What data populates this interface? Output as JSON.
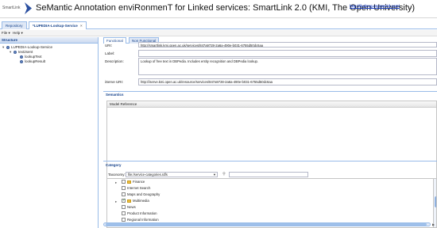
{
  "header": {
    "logo_text": "SmartLink",
    "title": "SeMantic Annotation enviRonmenT for Linked services: SmartLink 2.0 (KMI, The Open University)",
    "openid_link": "http://liudong.myopenid.com/",
    "right_text": "Lo"
  },
  "tabs": [
    {
      "label": "Repository"
    },
    {
      "label": "*LUPEDIA-Lookup-Service",
      "close": "×"
    }
  ],
  "menu": {
    "file": "File ▾",
    "help": "Help ▾"
  },
  "structure": {
    "title": "Structure",
    "nodes": [
      {
        "label": "LUPEDIA-Lookup-Service",
        "toggle": "▾"
      },
      {
        "label": "text2sent",
        "toggle": "▾"
      },
      {
        "label": "lookupText"
      },
      {
        "label": "lookupResult"
      }
    ]
  },
  "subtabs": {
    "functional": "Functional",
    "non_functional": "Non Functional"
  },
  "form": {
    "uri_label": "URI:",
    "uri_value": "http://smartlink.kmi.open.ac.uk/services/847a9728-2a6a-490e-b031-6755d50dc6aa",
    "label_label": "Label:",
    "label_value": "",
    "description_label": "Description:",
    "description_value": "Lookup of free text in DBPedia. Includes entity recognition and DBPedia lookup.",
    "iserve_label": "iServe URI:",
    "iserve_value": "http://iserve.kmi.open.ac.uk/resource/services/847a9728-2a6a-490e-b031-6755d50dc6aa"
  },
  "semantics": {
    "title": "Semantics",
    "column": "Model Reference"
  },
  "category": {
    "title": "Category",
    "taxonomy_label": "Taxonomy:",
    "taxonomy_value": "file:/service-categories.rdfs",
    "items": [
      {
        "label": "Finance",
        "folder": true,
        "toggle": "▸",
        "checked": false
      },
      {
        "label": "Internet Search",
        "folder": false,
        "checked": false
      },
      {
        "label": "Maps and Geography",
        "folder": false,
        "checked": false
      },
      {
        "label": "Multimedia",
        "folder": true,
        "toggle": "▸",
        "checked": true
      },
      {
        "label": "News",
        "folder": false,
        "checked": false
      },
      {
        "label": "Product Information",
        "folder": false,
        "checked": false
      },
      {
        "label": "Regional Information",
        "folder": false,
        "checked": false
      }
    ]
  }
}
